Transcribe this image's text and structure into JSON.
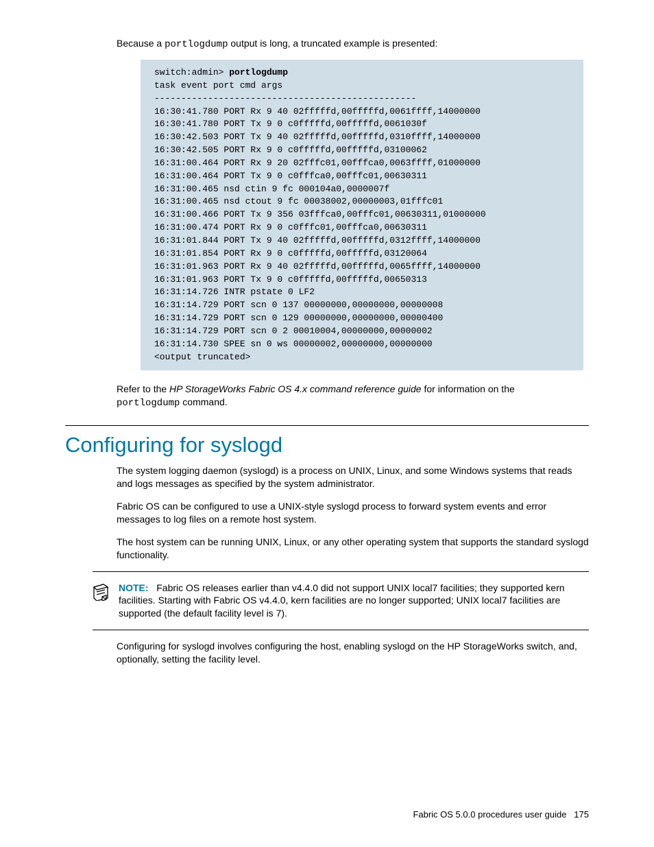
{
  "intro": {
    "before": "Because a ",
    "cmd": "portlogdump",
    "after": " output is long, a truncated example is presented:"
  },
  "code": {
    "prompt": "switch:admin> ",
    "command": "portlogdump",
    "lines": [
      "task event port cmd args",
      "-------------------------------------------------",
      "16:30:41.780 PORT Rx 9 40 02fffffd,00fffffd,0061ffff,14000000",
      "16:30:41.780 PORT Tx 9 0 c0fffffd,00fffffd,0061030f",
      "16:30:42.503 PORT Tx 9 40 02fffffd,00fffffd,0310ffff,14000000",
      "16:30:42.505 PORT Rx 9 0 c0fffffd,00fffffd,03100062",
      "16:31:00.464 PORT Rx 9 20 02fffc01,00fffca0,0063ffff,01000000",
      "16:31:00.464 PORT Tx 9 0 c0fffca0,00fffc01,00630311",
      "16:31:00.465 nsd ctin 9 fc 000104a0,0000007f",
      "16:31:00.465 nsd ctout 9 fc 00038002,00000003,01fffc01",
      "16:31:00.466 PORT Tx 9 356 03fffca0,00fffc01,00630311,01000000",
      "16:31:00.474 PORT Rx 9 0 c0fffc01,00fffca0,00630311",
      "16:31:01.844 PORT Tx 9 40 02fffffd,00fffffd,0312ffff,14000000",
      "16:31:01.854 PORT Rx 9 0 c0fffffd,00fffffd,03120064",
      "16:31:01.963 PORT Rx 9 40 02fffffd,00fffffd,0065ffff,14000000",
      "16:31:01.963 PORT Tx 9 0 c0fffffd,00fffffd,00650313",
      "16:31:14.726 INTR pstate 0 LF2",
      "16:31:14.729 PORT scn 0 137 00000000,00000000,00000008",
      "16:31:14.729 PORT scn 0 129 00000000,00000000,00000400",
      "16:31:14.729 PORT scn 0 2 00010004,00000000,00000002",
      "16:31:14.730 SPEE sn 0 ws 00000002,00000000,00000000",
      "<output truncated>"
    ]
  },
  "refer": {
    "before": "Refer to the ",
    "doc": "HP StorageWorks Fabric OS 4.x command reference guide",
    "mid": " for information on the ",
    "cmd": "portlogdump",
    "after": " command."
  },
  "heading": "Configuring for syslogd",
  "paras": {
    "p1": "The system logging daemon (syslogd) is a process on UNIX, Linux, and some Windows systems that reads and logs messages as specified by the system administrator.",
    "p2": "Fabric OS can be configured to use a UNIX-style syslogd process to forward system events and error messages to log files on a remote host system.",
    "p3": "The host system can be running UNIX, Linux, or any other operating system that supports the standard syslogd functionality.",
    "p4": "Configuring for syslogd involves configuring the host, enabling syslogd on the HP StorageWorks switch, and, optionally, setting the facility level."
  },
  "note": {
    "label": "NOTE:",
    "text": "Fabric OS releases earlier than v4.4.0 did not support UNIX local7 facilities; they supported kern facilities. Starting with Fabric OS v4.4.0, kern facilities are no longer supported; UNIX local7 facilities are supported (the default facility level is 7)."
  },
  "footer": {
    "title": "Fabric OS 5.0.0 procedures user guide",
    "page": "175"
  }
}
